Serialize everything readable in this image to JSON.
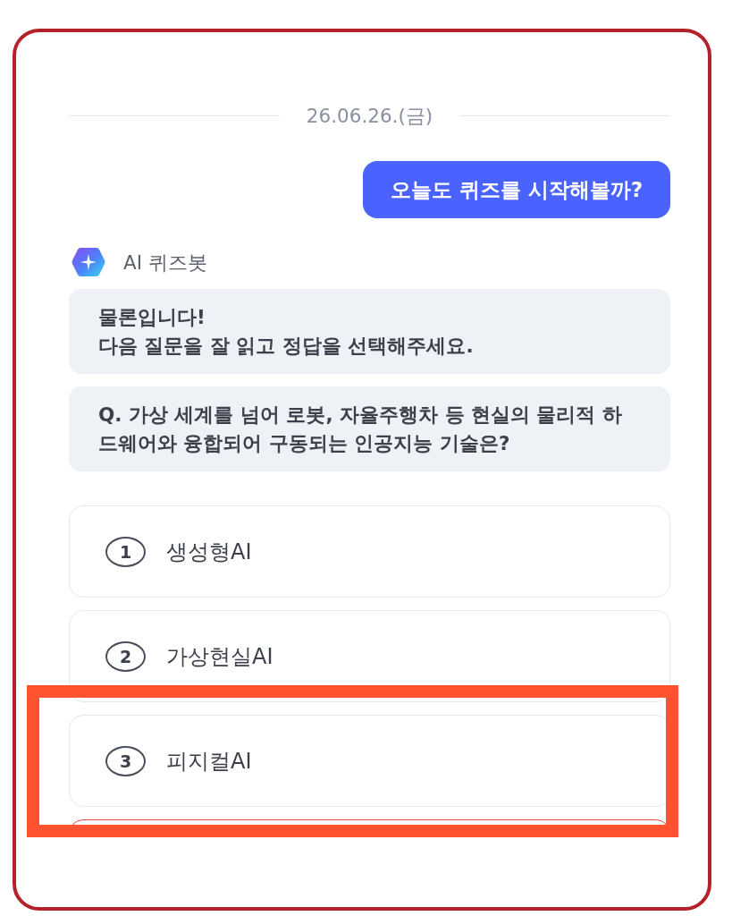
{
  "date_divider": {
    "label": "26.06.26.(금)"
  },
  "user_message": {
    "text": "오늘도 퀴즈를 시작해볼까?"
  },
  "bot": {
    "name": "AI 퀴즈봇"
  },
  "bot_messages": [
    {
      "text": "물론입니다!\n다음 질문을 잘 읽고 정답을 선택해주세요."
    },
    {
      "text": "Q. 가상 세계를 넘어 로봇, 자율주행차 등 현실의 물리적 하드웨어와 융합되어 구동되는 인공지능 기술은?"
    }
  ],
  "options": [
    {
      "number": "1",
      "label": "생성형AI",
      "selected": false,
      "highlighted": false
    },
    {
      "number": "2",
      "label": "가상현실AI",
      "selected": false,
      "highlighted": false
    },
    {
      "number": "3",
      "label": "피지컬AI",
      "selected": false,
      "highlighted": true
    },
    {
      "selected": true,
      "highlighted": false
    }
  ]
}
